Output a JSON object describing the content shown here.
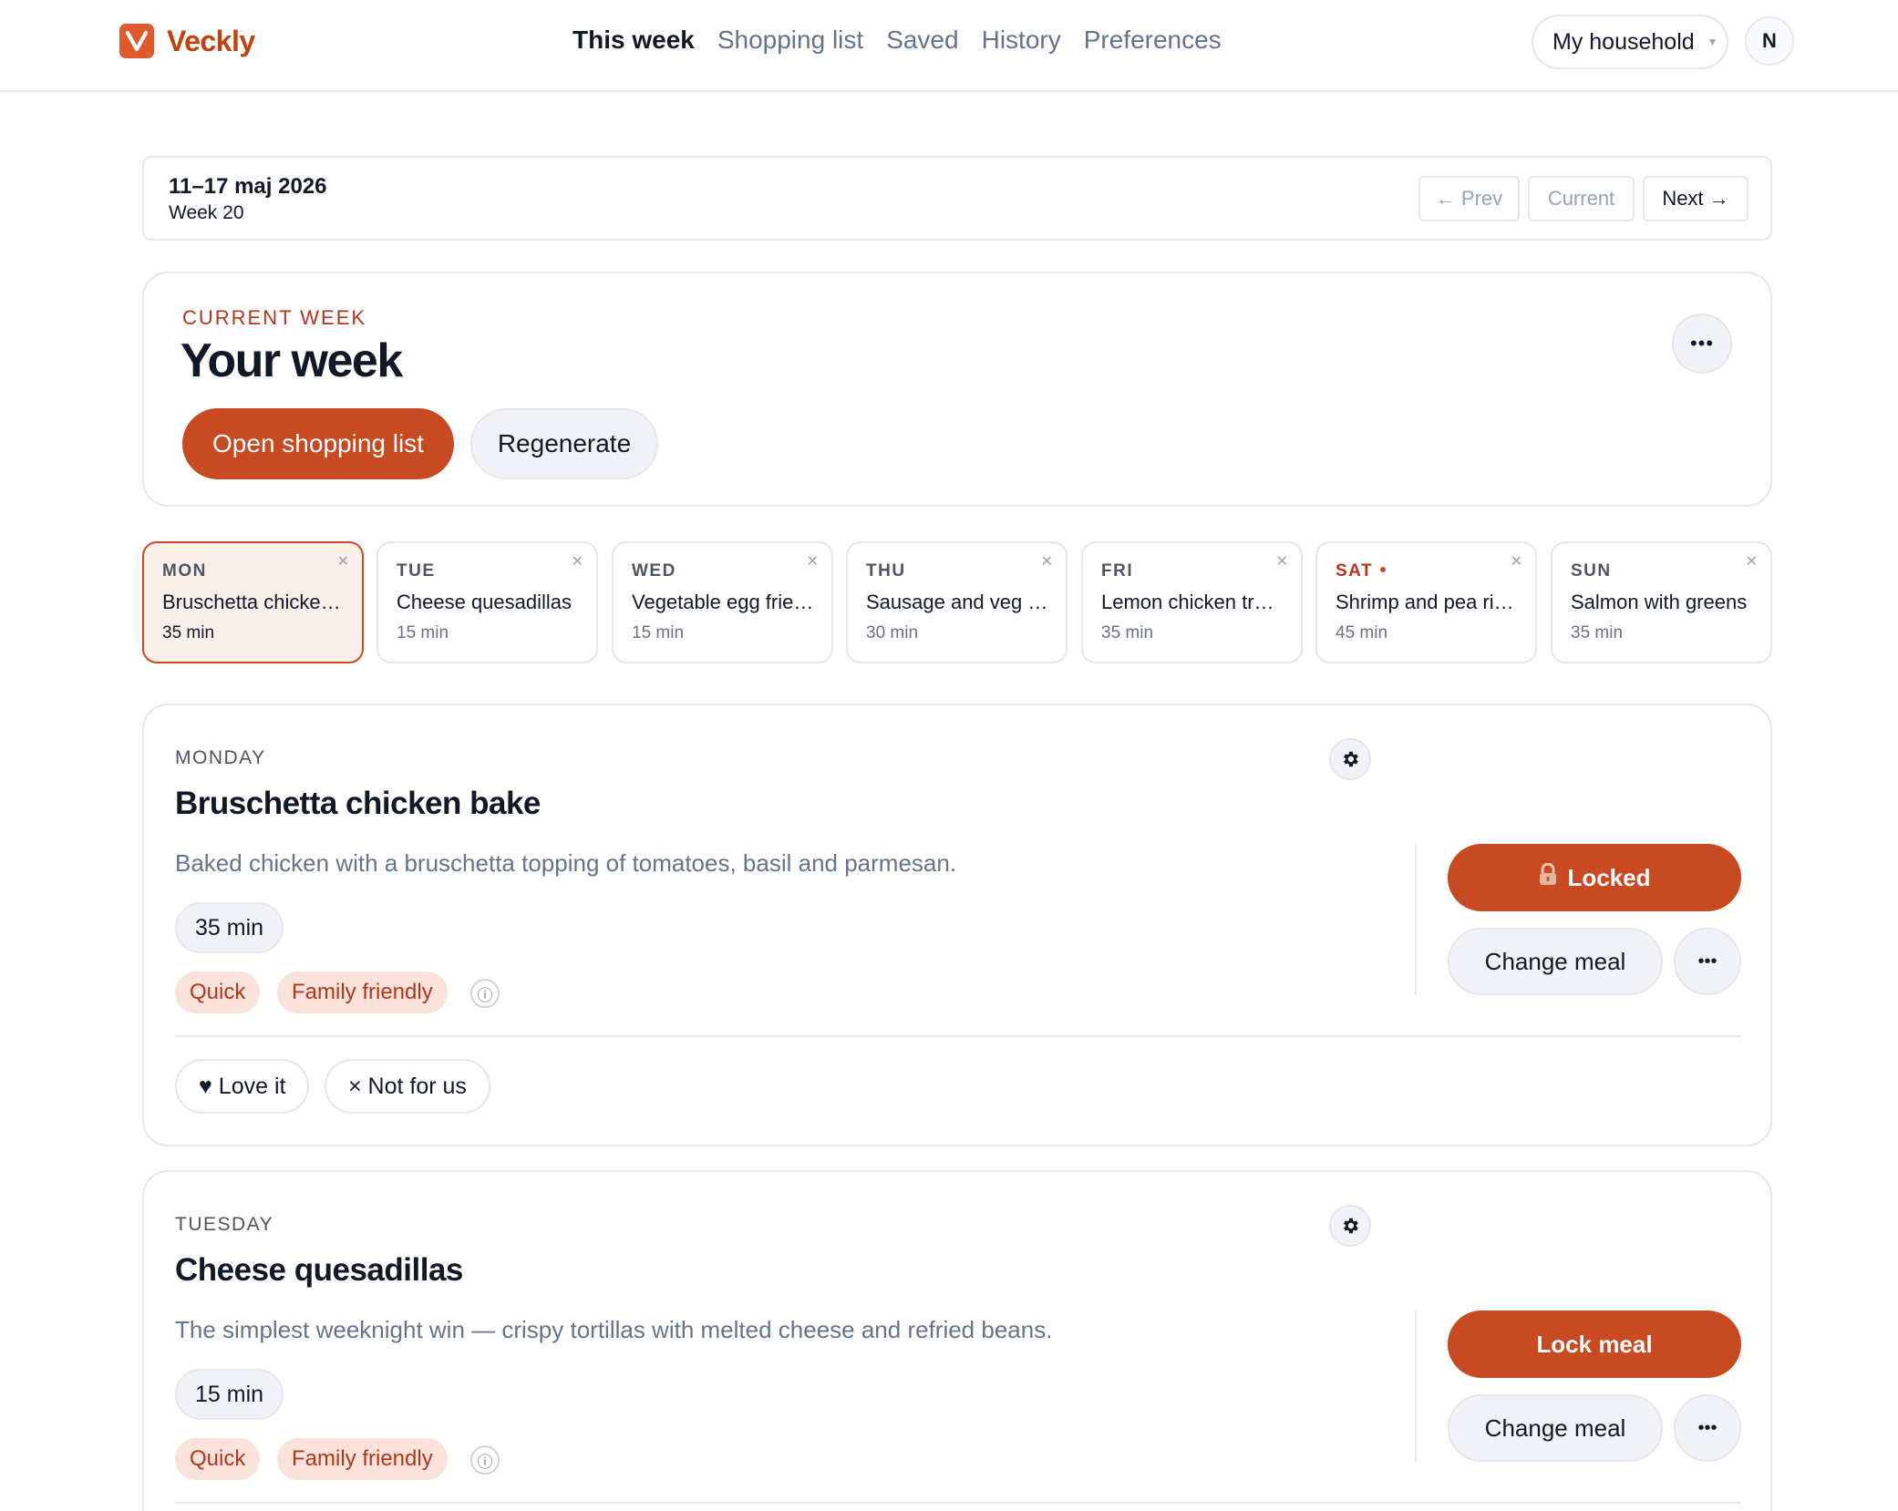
{
  "brand": {
    "name": "Veckly"
  },
  "nav": {
    "items": [
      {
        "label": "This week",
        "active": true
      },
      {
        "label": "Shopping list",
        "active": false
      },
      {
        "label": "Saved",
        "active": false
      },
      {
        "label": "History",
        "active": false
      },
      {
        "label": "Preferences",
        "active": false
      }
    ],
    "household": "My household",
    "avatar_initial": "N"
  },
  "range": {
    "dates": "11–17 maj 2026",
    "week": "Week 20",
    "prev": "← Prev",
    "current": "Current",
    "next": "Next →"
  },
  "hero": {
    "kicker": "CURRENT WEEK",
    "title": "Your week",
    "primary": "Open shopping list",
    "secondary": "Regenerate",
    "more": "•••"
  },
  "days": [
    {
      "abbr": "MON",
      "name": "Bruschetta chicken bake",
      "time": "35 min",
      "selected": true
    },
    {
      "abbr": "TUE",
      "name": "Cheese quesadillas",
      "time": "15 min",
      "selected": false
    },
    {
      "abbr": "WED",
      "name": "Vegetable egg fried rice",
      "time": "15 min",
      "selected": false
    },
    {
      "abbr": "THU",
      "name": "Sausage and veg traybake",
      "time": "30 min",
      "selected": false
    },
    {
      "abbr": "FRI",
      "name": "Lemon chicken traybake",
      "time": "35 min",
      "selected": false
    },
    {
      "abbr": "SAT",
      "name": "Shrimp and pea risotto",
      "time": "45 min",
      "selected": false,
      "dot": true
    },
    {
      "abbr": "SUN",
      "name": "Salmon with greens",
      "time": "35 min",
      "selected": false
    }
  ],
  "meals": [
    {
      "day": "MONDAY",
      "title": "Bruschetta chicken bake",
      "description": "Baked chicken with a bruschetta topping of tomatoes, basil and parmesan.",
      "time": "35 min",
      "tags": [
        "Quick",
        "Family friendly"
      ],
      "info": "ⓘ",
      "primary_action": "Locked",
      "change": "Change meal",
      "more": "•••",
      "love": "♥ Love it",
      "nope": "× Not for us"
    },
    {
      "day": "TUESDAY",
      "title": "Cheese quesadillas",
      "description": "The simplest weeknight win — crispy tortillas with melted cheese and refried beans.",
      "time": "15 min",
      "tags": [
        "Quick",
        "Family friendly"
      ],
      "info": "ⓘ",
      "primary_action": "Lock meal",
      "change": "Change meal",
      "more": "•••"
    }
  ],
  "icons": {
    "logo": "veckly-logo-icon",
    "gear": "gear-icon",
    "lock": "lock-icon",
    "close": "close-icon",
    "more": "more-icon",
    "info": "info-icon"
  },
  "colors": {
    "accent": "#c84a22",
    "brand": "#df5a2d",
    "tag_bg": "#fbe3dc",
    "tag_text": "#b4361a",
    "selected_bg": "#fbefea"
  }
}
